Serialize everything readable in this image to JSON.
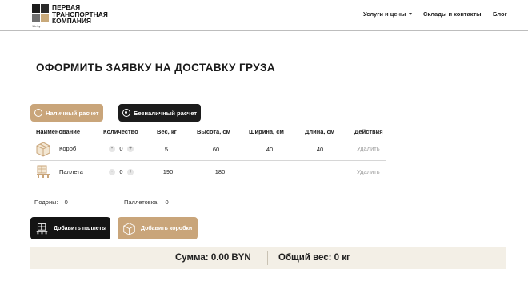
{
  "header": {
    "logo": {
      "line1": "ПЕРВАЯ",
      "line2": "ТРАНСПОРТНАЯ",
      "line3": "КОМПАНИЯ",
      "sub": "1tk.by"
    },
    "nav": {
      "services": "Услуги и цены",
      "warehouses": "Склады и контакты",
      "blog": "Блог"
    }
  },
  "page": {
    "title": "ОФОРМИТЬ ЗАЯВКУ НА ДОСТАВКУ ГРУЗА"
  },
  "payment": {
    "cash": "Наличный расчет",
    "cashless": "Безналичный расчет",
    "selected": "cashless"
  },
  "table": {
    "headers": [
      "Наименование",
      "Количество",
      "Вес, кг",
      "Высота, см",
      "Ширина, см",
      "Длина, см",
      "Действия"
    ],
    "rows": [
      {
        "name": "Короб",
        "icon": "box-icon",
        "qty": "0",
        "weight": "5",
        "height": "60",
        "width": "40",
        "length": "40",
        "action": "Удалить"
      },
      {
        "name": "Паллета",
        "icon": "pallet-icon",
        "qty": "0",
        "weight": "190",
        "height": "180",
        "width": "",
        "length": "",
        "action": "Удалить"
      }
    ],
    "stepper": {
      "minus": "-",
      "plus": "+"
    }
  },
  "summary": {
    "pallets_label": "Подоны:",
    "pallets_value": "0",
    "wrapping_label": "Паллетовка:",
    "wrapping_value": "0"
  },
  "buttons": {
    "add_pallets": "Добавить паллеты",
    "add_boxes": "Добавить коробки"
  },
  "totals": {
    "sum": "Сумма:  0.00 BYN",
    "weight": "Общий вес:  0 кг"
  },
  "colors": {
    "accent": "#c9a57a",
    "dark": "#1c1c1c",
    "totals_bg": "#f3efe6"
  }
}
